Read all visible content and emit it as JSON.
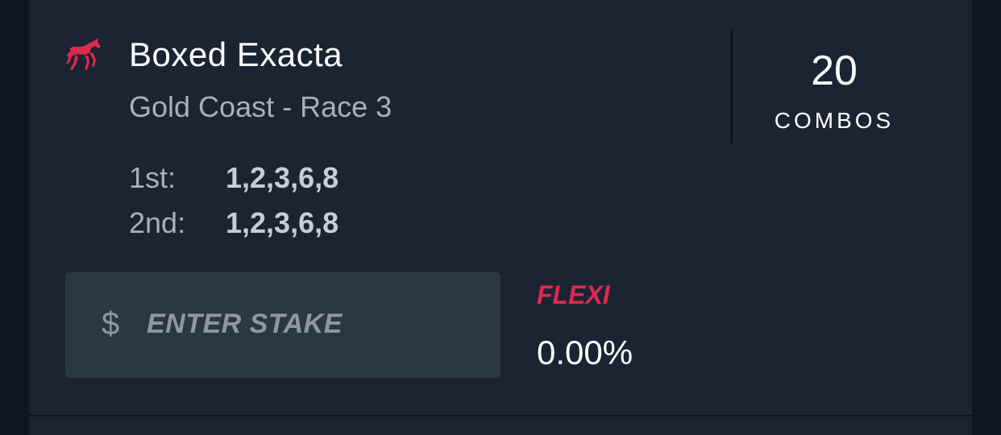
{
  "bet": {
    "type": "Boxed Exacta",
    "race": "Gold Coast - Race 3",
    "icon": "horse-racing-icon",
    "combos_value": "20",
    "combos_label": "COMBOS",
    "legs": [
      {
        "label": "1st:",
        "selections": "1,2,3,6,8"
      },
      {
        "label": "2nd:",
        "selections": "1,2,3,6,8"
      }
    ]
  },
  "stake": {
    "currency": "$",
    "placeholder": "ENTER STAKE"
  },
  "flexi": {
    "label": "FLEXI",
    "value": "0.00%"
  },
  "colors": {
    "background": "#0f1722",
    "card": "#1a2432",
    "input": "#2c3745",
    "accent": "#e0284f"
  }
}
